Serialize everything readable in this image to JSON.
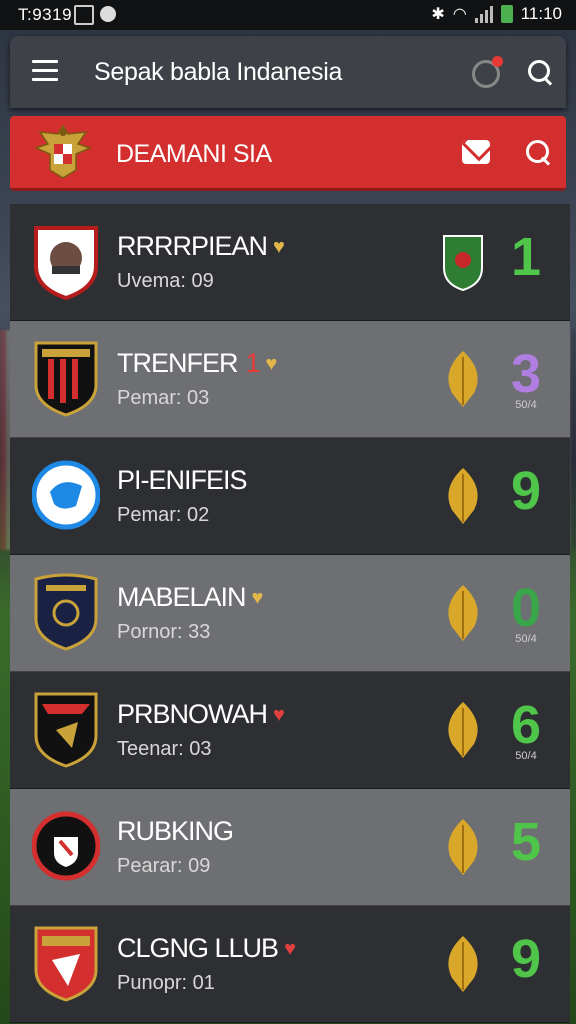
{
  "status_bar": {
    "time_left": "T:9319",
    "time_right": "11:10"
  },
  "app_bar": {
    "title": "Sepak babla Indanesia",
    "icons": [
      "menu-icon",
      "notification-icon",
      "search-icon"
    ]
  },
  "league_header": {
    "name": "DEAMANI SIA",
    "icons": [
      "garuda-logo",
      "mail-icon",
      "search-icon"
    ],
    "accent": "#d32f2f"
  },
  "teams": [
    {
      "name": "RRRRPIEAN",
      "badge_mark": "",
      "heart_color": "#e2b64a",
      "sub": "Uvema: 09",
      "score": "1",
      "score_sub": "",
      "score_color": "#4fc64a",
      "right_icon": "green-shield-icon",
      "theme": "dark"
    },
    {
      "name": "TRENFER",
      "badge_mark": "1",
      "heart_color": "#e2b64a",
      "sub": "Pemar: 03",
      "score": "3",
      "score_sub": "50/4",
      "score_color": "#b07ee0",
      "right_icon": "leaf-icon",
      "theme": "light"
    },
    {
      "name": "PI-ENIFEIS",
      "badge_mark": "",
      "heart_color": "",
      "sub": "Pemar: 02",
      "score": "9",
      "score_sub": "",
      "score_color": "#4fc64a",
      "right_icon": "leaf-icon",
      "theme": "dark"
    },
    {
      "name": "MABELAIN",
      "badge_mark": "",
      "heart_color": "#e2b64a",
      "sub": "Pornor: 33",
      "score": "0",
      "score_sub": "50/4",
      "score_color": "#3aa64a",
      "right_icon": "leaf-icon",
      "theme": "light"
    },
    {
      "name": "PRBNOWAH",
      "badge_mark": "",
      "heart_color": "#e04040",
      "sub": "Teenar: 03",
      "score": "6",
      "score_sub": "50/4",
      "score_color": "#4fc64a",
      "right_icon": "leaf-icon",
      "theme": "dark"
    },
    {
      "name": "RUBKING",
      "badge_mark": "",
      "heart_color": "",
      "sub": "Pearar: 09",
      "score": "5",
      "score_sub": "",
      "score_color": "#4fc64a",
      "right_icon": "leaf-icon",
      "theme": "light"
    },
    {
      "name": "CLGNG LLUB",
      "badge_mark": "",
      "heart_color": "#e04040",
      "sub": "Punopr: 01",
      "score": "9",
      "score_sub": "",
      "score_color": "#4fc64a",
      "right_icon": "leaf-icon",
      "theme": "dark"
    }
  ]
}
